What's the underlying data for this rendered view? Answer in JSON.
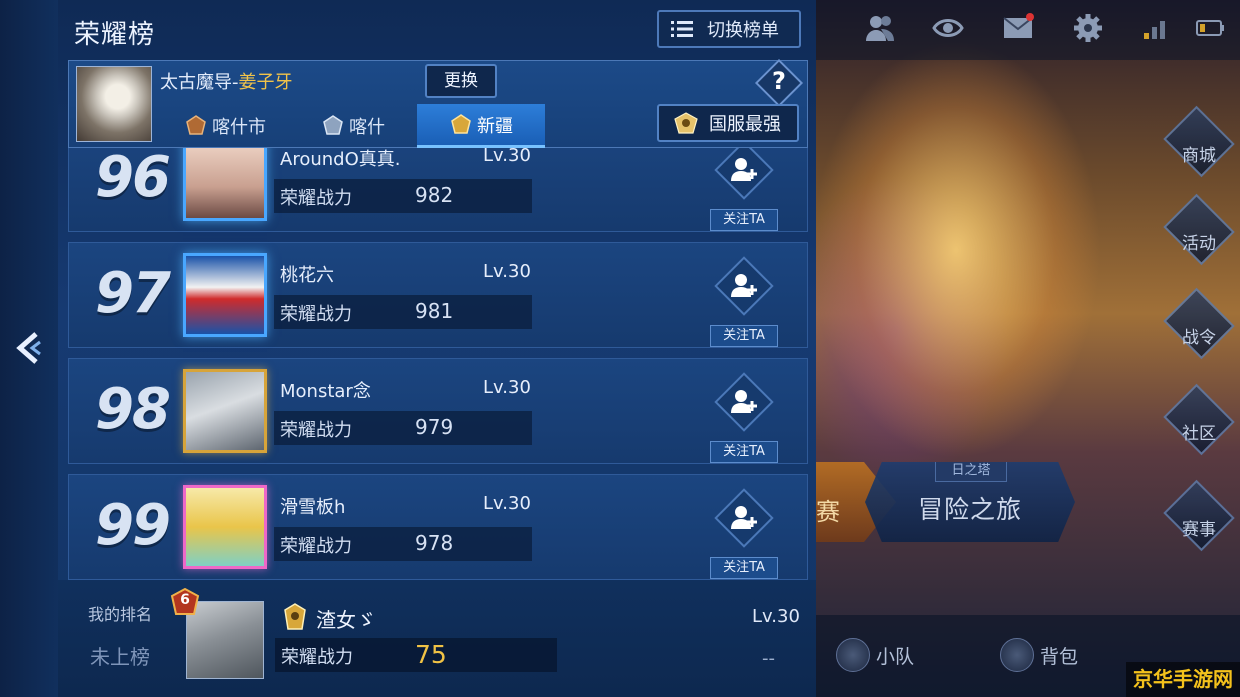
{
  "panel": {
    "title": "荣耀榜",
    "switch_label": "切换榜单"
  },
  "hero": {
    "name_prefix": "太古魔导-",
    "name_highlight": "姜子牙",
    "change_label": "更换",
    "help_label": "?"
  },
  "regions": [
    {
      "label": "喀什市",
      "active": false
    },
    {
      "label": "喀什",
      "active": false
    },
    {
      "label": "新疆",
      "active": true
    }
  ],
  "national_label": "国服最强",
  "power_label": "荣耀战力",
  "follow_label": "关注TA",
  "rows": [
    {
      "rank": "96",
      "name": "AroundO真真.",
      "level": "Lv.30",
      "power": "982"
    },
    {
      "rank": "97",
      "name": "桃花六",
      "level": "Lv.30",
      "power": "981"
    },
    {
      "rank": "98",
      "name": "Monstar念",
      "level": "Lv.30",
      "power": "979"
    },
    {
      "rank": "99",
      "name": "滑雪板h",
      "level": "Lv.30",
      "power": "978"
    }
  ],
  "mine": {
    "label": "我的排名",
    "status": "未上榜",
    "badge": "6",
    "name": "渣女ゞ",
    "level": "Lv.30",
    "power": "75",
    "rank_change": "--"
  },
  "scene": {
    "side_entries": [
      "商城",
      "活动",
      "战令",
      "社区",
      "赛事"
    ],
    "adventure_tag": "日之塔",
    "adventure_name": "冒险之旅",
    "match_partial": "赛",
    "bottom_entries": [
      "小队",
      "背包"
    ],
    "watermark": "京华手游网"
  },
  "colors": {
    "panel_bg": "#163a72",
    "active_tab": "#2d7ed9",
    "highlight": "#f1c34a"
  }
}
